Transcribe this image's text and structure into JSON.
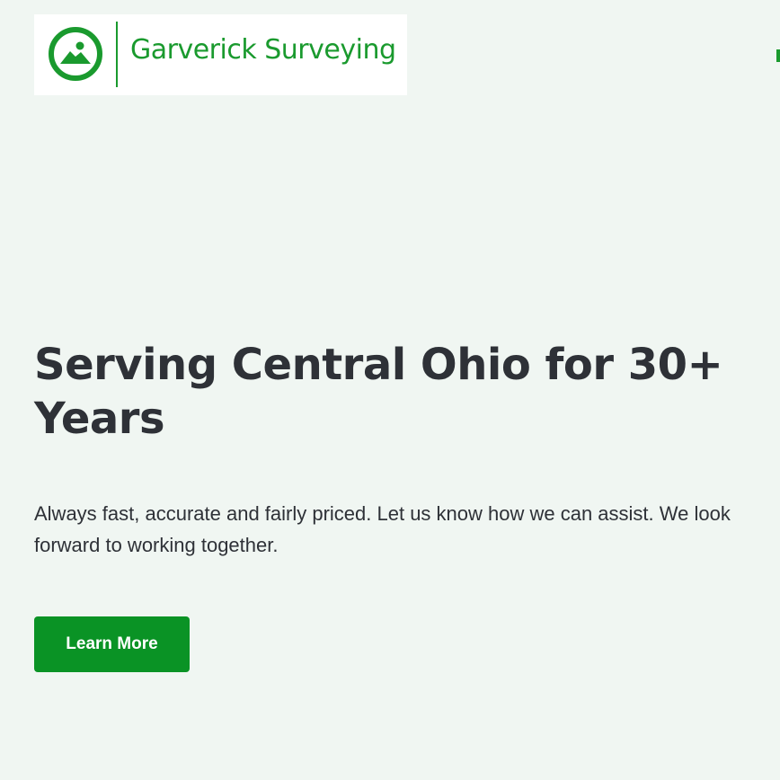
{
  "header": {
    "logo": {
      "icon": "mountain-sun-icon",
      "text": "Garverick Surveying",
      "color": "#1a9a2e"
    },
    "menu_icon": "menu-icon"
  },
  "hero": {
    "title": "Serving Central Ohio for 30+ Years",
    "description": "Always fast, accurate and fairly priced. Let us know how we can assist. We look forward to working together.",
    "cta_label": "Learn More",
    "cta_color": "#0a9325"
  },
  "colors": {
    "background": "#f0f6f2",
    "heading": "#2e3137",
    "accent": "#1a9a2e"
  }
}
